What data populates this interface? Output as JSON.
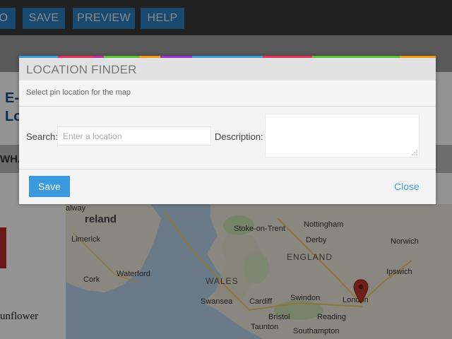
{
  "topbar": {
    "buttons": [
      "O",
      "SAVE",
      "PREVIEW",
      "HELP"
    ]
  },
  "page": {
    "title_line1": "E-C",
    "title_line2": "Lo",
    "nav_text": "WHA",
    "side_text": "unflower"
  },
  "map": {
    "labels": {
      "ireland": "reland",
      "galway": "alway",
      "limerick": "Limerick",
      "waterford": "Waterford",
      "cork": "Cork",
      "stoke": "Stoke-on-Trent",
      "nottingham": "Nottingham",
      "derby": "Derby",
      "england": "ENGLAND",
      "norwich": "Norwich",
      "wales": "WALES",
      "ipswich": "Ipswich",
      "swansea": "Swansea",
      "cardiff": "Cardiff",
      "swindon": "Swindon",
      "london": "London",
      "bristol": "Bristol",
      "reading": "Reading",
      "taunton": "Taunton",
      "southampton": "Southampton"
    },
    "colors": {
      "sea": "#b9d3ea",
      "land": "#eee9de",
      "green": "#cfe3b5",
      "marker": "#c0392b"
    }
  },
  "modal": {
    "title": "LOCATION FINDER",
    "subtitle": "Select pin location for the map",
    "search_label": "Search:",
    "search_placeholder": "Enter a location",
    "search_value": "",
    "description_label": "Description:",
    "description_value": "",
    "save_label": "Save",
    "close_label": "Close",
    "strip_colors": [
      "#3aa0dd",
      "#e8315f",
      "#c32ba8",
      "#58c634",
      "#f39c12",
      "#9b30d9",
      "#3aa0dd",
      "#e8315f",
      "#58c634",
      "#f39c12"
    ],
    "icons": {
      "resize": "resize-grip-icon",
      "marker": "map-marker-icon"
    }
  }
}
